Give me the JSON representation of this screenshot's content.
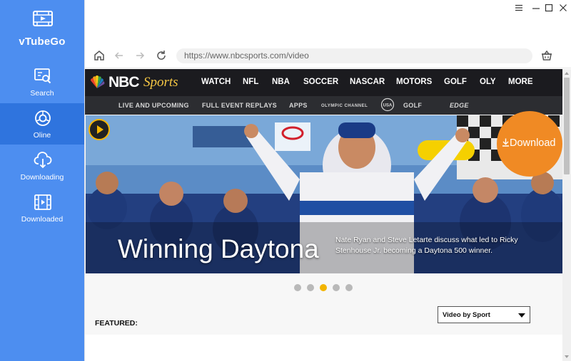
{
  "app": {
    "name": "vTubeGo"
  },
  "sidebar": {
    "items": [
      {
        "label": "Search",
        "icon": "search-icon",
        "active": false
      },
      {
        "label": "Oline",
        "icon": "globe-icon",
        "active": true
      },
      {
        "label": "Downloading",
        "icon": "cloud-download-icon",
        "active": false
      },
      {
        "label": "Downloaded",
        "icon": "film-icon",
        "active": false
      }
    ]
  },
  "browser": {
    "url": "https://www.nbcsports.com/video"
  },
  "site": {
    "logo_nbc": "NBC",
    "logo_sports": "Sports",
    "top_nav": [
      "WATCH",
      "NFL",
      "NBA",
      "SOCCER",
      "NASCAR",
      "MOTORS",
      "GOLF",
      "OLY",
      "MORE"
    ],
    "sub_nav": [
      "LIVE AND UPCOMING",
      "FULL EVENT REPLAYS",
      "APPS"
    ],
    "sub_logos": [
      "OLYMPIC CHANNEL",
      "USA",
      "GOLF",
      "EDGE"
    ]
  },
  "hero": {
    "title": "Winning Daytona",
    "description": "Nate Ryan and Steve Letarte discuss what led to Ricky Stenhouse Jr. becoming a Daytona 500 winner.",
    "slides": 5,
    "active_slide": 3
  },
  "download_button": {
    "label": "Download"
  },
  "featured": {
    "heading": "FEATURED:",
    "select_value": "Video by Sport"
  },
  "colors": {
    "sidebar": "#4d8ef0",
    "sidebar_active": "#2f74de",
    "download": "#f08a24",
    "nbc_bar": "#1b1b1f",
    "active_dot": "#f2b400"
  }
}
